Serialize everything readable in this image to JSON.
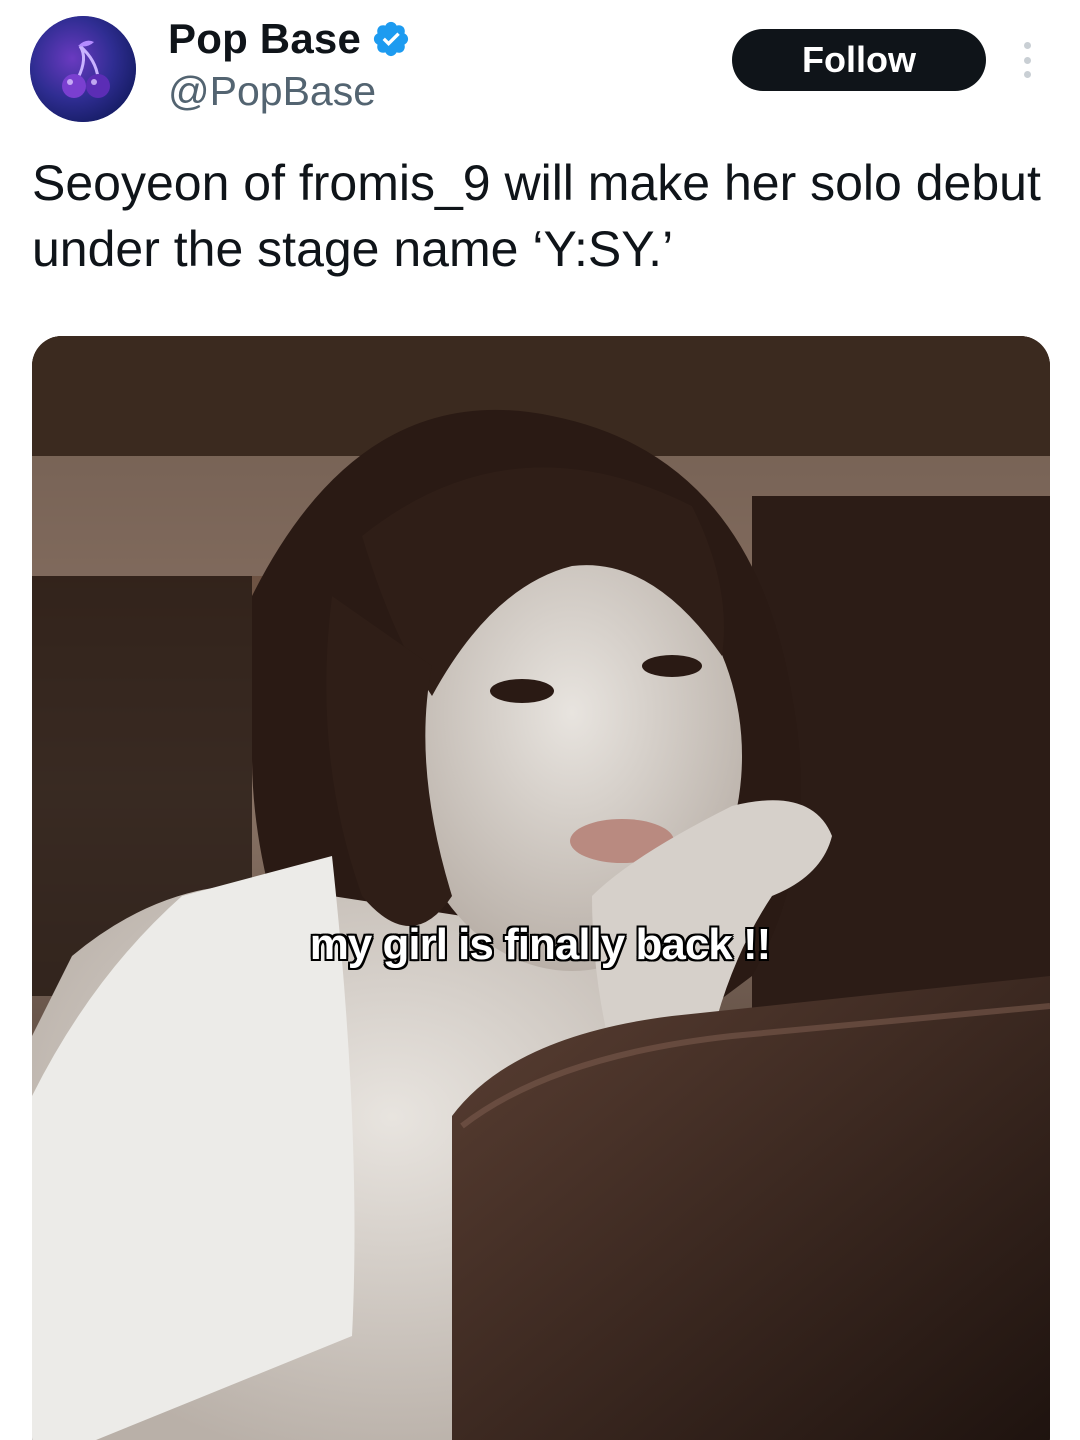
{
  "account": {
    "display_name": "Pop Base",
    "handle": "@PopBase",
    "verified": true,
    "avatar_icon": "cherry-icon"
  },
  "actions": {
    "follow_label": "Follow",
    "more_icon": "more-vertical-icon"
  },
  "tweet": {
    "text": "Seoyeon of fromis_9 will make her solo debut under the stage name ‘Y:SY.’"
  },
  "media": {
    "caption_overlay": "my girl is finally back !!"
  },
  "colors": {
    "follow_bg": "#0f1419",
    "verified_blue": "#1d9bf0",
    "handle_gray": "#536471"
  }
}
